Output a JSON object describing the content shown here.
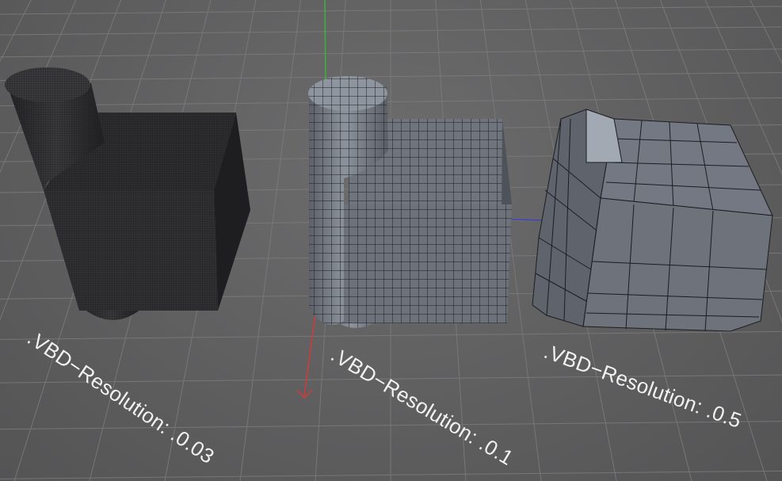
{
  "viewport": {
    "objects": [
      {
        "id": "obj-003",
        "label": ".VBD−Resolution: .0.03"
      },
      {
        "id": "obj-01",
        "label": ".VBD−Resolution: .0.1"
      },
      {
        "id": "obj-05",
        "label": ".VBD−Resolution: .0.5"
      }
    ],
    "colors": {
      "background": "#5f5f60",
      "grid_line": "#7a7a7b",
      "dark_mesh": "#2a2a2c",
      "medium_mesh": "#6c717a",
      "light_mesh": "#828893",
      "wire": "#1b1d21",
      "axis_x": "#d23a3a",
      "axis_y": "#3ab43a",
      "axis_z": "#3a3ad2",
      "label_text": "#f2f2f2"
    },
    "axes": [
      "x-axis",
      "y-axis",
      "z-axis"
    ]
  }
}
